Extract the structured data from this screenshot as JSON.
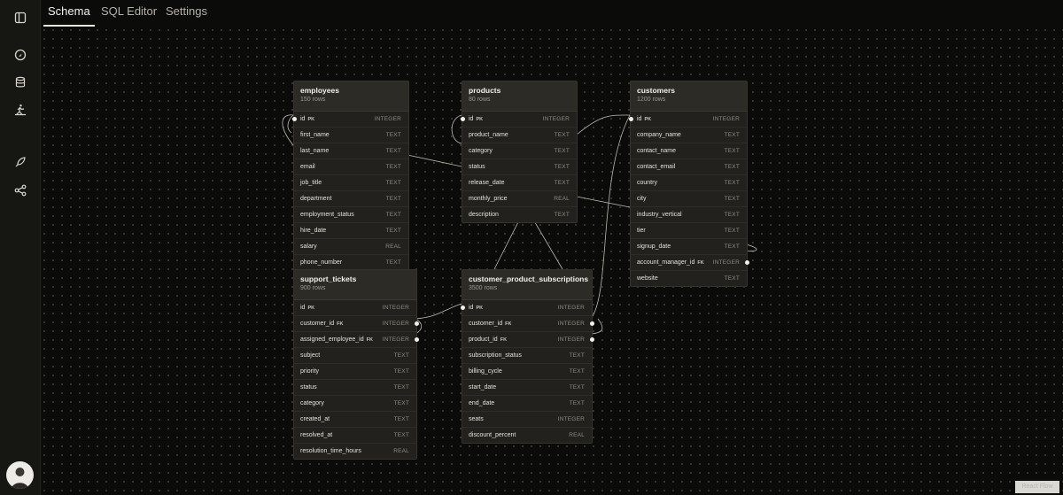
{
  "tabs": [
    {
      "label": "Schema",
      "active": true
    },
    {
      "label": "SQL Editor",
      "active": false
    },
    {
      "label": "Settings",
      "active": false
    }
  ],
  "sidebar": {
    "icons": [
      "sidebar-toggle-icon",
      "dashboard-gauge-icon",
      "database-icon",
      "activity-icon",
      "rocket-icon",
      "share-icon"
    ]
  },
  "watermark": "React Flow",
  "tables": {
    "employees": {
      "name": "employees",
      "rows": "150 rows",
      "columns": [
        {
          "name": "id",
          "key": "PK",
          "type": "INTEGER"
        },
        {
          "name": "first_name",
          "key": "",
          "type": "TEXT"
        },
        {
          "name": "last_name",
          "key": "",
          "type": "TEXT"
        },
        {
          "name": "email",
          "key": "",
          "type": "TEXT"
        },
        {
          "name": "job_title",
          "key": "",
          "type": "TEXT"
        },
        {
          "name": "department",
          "key": "",
          "type": "TEXT"
        },
        {
          "name": "employment_status",
          "key": "",
          "type": "TEXT"
        },
        {
          "name": "hire_date",
          "key": "",
          "type": "TEXT"
        },
        {
          "name": "salary",
          "key": "",
          "type": "REAL"
        },
        {
          "name": "phone_number",
          "key": "",
          "type": "TEXT"
        }
      ]
    },
    "products": {
      "name": "products",
      "rows": "80 rows",
      "columns": [
        {
          "name": "id",
          "key": "PK",
          "type": "INTEGER"
        },
        {
          "name": "product_name",
          "key": "",
          "type": "TEXT"
        },
        {
          "name": "category",
          "key": "",
          "type": "TEXT"
        },
        {
          "name": "status",
          "key": "",
          "type": "TEXT"
        },
        {
          "name": "release_date",
          "key": "",
          "type": "TEXT"
        },
        {
          "name": "monthly_price",
          "key": "",
          "type": "REAL"
        },
        {
          "name": "description",
          "key": "",
          "type": "TEXT"
        }
      ]
    },
    "customers": {
      "name": "customers",
      "rows": "1200 rows",
      "columns": [
        {
          "name": "id",
          "key": "PK",
          "type": "INTEGER"
        },
        {
          "name": "company_name",
          "key": "",
          "type": "TEXT"
        },
        {
          "name": "contact_name",
          "key": "",
          "type": "TEXT"
        },
        {
          "name": "contact_email",
          "key": "",
          "type": "TEXT"
        },
        {
          "name": "country",
          "key": "",
          "type": "TEXT"
        },
        {
          "name": "city",
          "key": "",
          "type": "TEXT"
        },
        {
          "name": "industry_vertical",
          "key": "",
          "type": "TEXT"
        },
        {
          "name": "tier",
          "key": "",
          "type": "TEXT"
        },
        {
          "name": "signup_date",
          "key": "",
          "type": "TEXT"
        },
        {
          "name": "account_manager_id",
          "key": "FK",
          "type": "INTEGER"
        },
        {
          "name": "website",
          "key": "",
          "type": "TEXT"
        }
      ]
    },
    "support_tickets": {
      "name": "support_tickets",
      "rows": "900 rows",
      "columns": [
        {
          "name": "id",
          "key": "PK",
          "type": "INTEGER"
        },
        {
          "name": "customer_id",
          "key": "FK",
          "type": "INTEGER"
        },
        {
          "name": "assigned_employee_id",
          "key": "FK",
          "type": "INTEGER"
        },
        {
          "name": "subject",
          "key": "",
          "type": "TEXT"
        },
        {
          "name": "priority",
          "key": "",
          "type": "TEXT"
        },
        {
          "name": "status",
          "key": "",
          "type": "TEXT"
        },
        {
          "name": "category",
          "key": "",
          "type": "TEXT"
        },
        {
          "name": "created_at",
          "key": "",
          "type": "TEXT"
        },
        {
          "name": "resolved_at",
          "key": "",
          "type": "TEXT"
        },
        {
          "name": "resolution_time_hours",
          "key": "",
          "type": "REAL"
        }
      ]
    },
    "customer_product_subscriptions": {
      "name": "customer_product_subscriptions",
      "rows": "3500 rows",
      "columns": [
        {
          "name": "id",
          "key": "PK",
          "type": "INTEGER"
        },
        {
          "name": "customer_id",
          "key": "FK",
          "type": "INTEGER"
        },
        {
          "name": "product_id",
          "key": "FK",
          "type": "INTEGER"
        },
        {
          "name": "subscription_status",
          "key": "",
          "type": "TEXT"
        },
        {
          "name": "billing_cycle",
          "key": "",
          "type": "TEXT"
        },
        {
          "name": "start_date",
          "key": "",
          "type": "TEXT"
        },
        {
          "name": "end_date",
          "key": "",
          "type": "TEXT"
        },
        {
          "name": "seats",
          "key": "",
          "type": "INTEGER"
        },
        {
          "name": "discount_percent",
          "key": "",
          "type": "REAL"
        }
      ]
    }
  }
}
